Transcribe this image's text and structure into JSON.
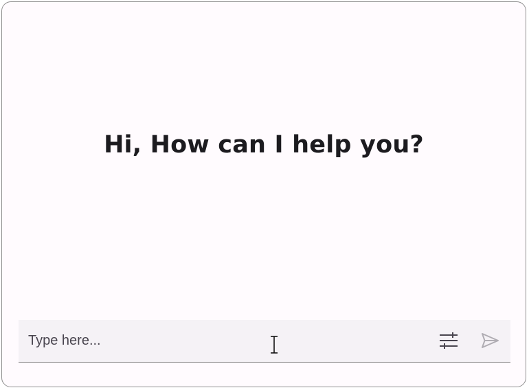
{
  "chat": {
    "greeting": "Hi, How can I help you?"
  },
  "composer": {
    "placeholder": "Type here...",
    "value": "",
    "options_icon": "tune-sliders-icon",
    "send_icon": "send-icon",
    "send_enabled": false
  },
  "colors": {
    "background": "#fffbfe",
    "border": "#8f8f8f",
    "text": "#1c1b1f",
    "composer_background": "#f5f2f6",
    "icon": "#49454f",
    "icon_disabled": "#b0adb3"
  }
}
